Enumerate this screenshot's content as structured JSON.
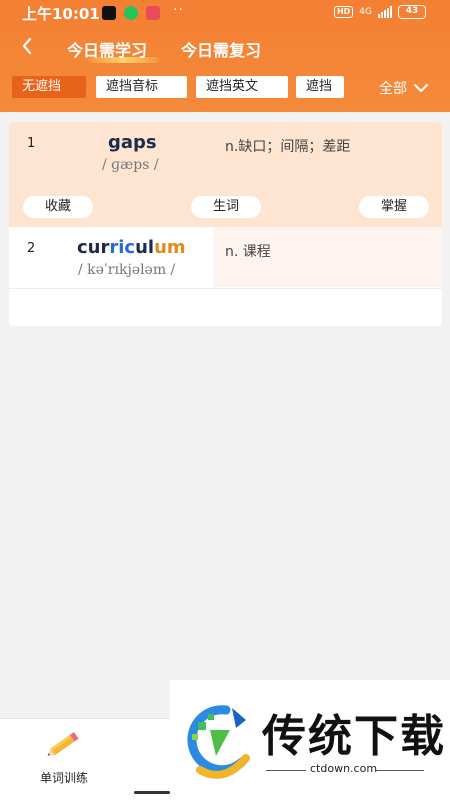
{
  "status_bar": {
    "time": "上午10:01",
    "dots": "··",
    "hd": "HD",
    "network": "4G",
    "battery": "43"
  },
  "nav": {
    "tabs": [
      {
        "label": "今日需学习",
        "active": true
      },
      {
        "label": "今日需复习",
        "active": false
      }
    ]
  },
  "filters": {
    "chips": [
      {
        "label": "无遮挡",
        "active": true
      },
      {
        "label": "遮挡音标",
        "active": false
      },
      {
        "label": "遮挡英文",
        "active": false
      },
      {
        "label": "遮挡",
        "active": false
      }
    ],
    "scope_label": "全部"
  },
  "words": [
    {
      "index": "1",
      "word": "gaps",
      "phonetic": "/ ɡæps /",
      "meaning": "n.缺口；间隔；差距",
      "actions": [
        "收藏",
        "生词",
        "掌握"
      ]
    },
    {
      "index": "2",
      "word_parts": [
        "cur",
        "ric",
        "ul",
        "um"
      ],
      "phonetic": "/ kəˈrɪkjələm /",
      "meaning": "n. 课程"
    }
  ],
  "bottom_nav": {
    "items": [
      {
        "label": "单词训练",
        "icon": "pencil-icon"
      }
    ]
  },
  "watermark": {
    "title": "传统下载",
    "url": "ctdown.com"
  },
  "colors": {
    "header": "#f37f33",
    "active_chip": "#e8631a",
    "row_highlight": "#fde5d2"
  }
}
